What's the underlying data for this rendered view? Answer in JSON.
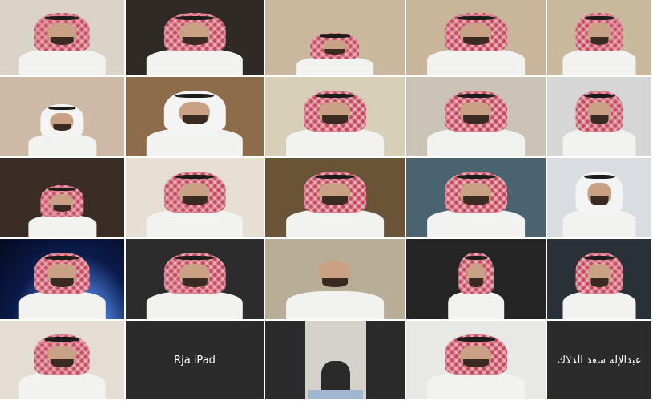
{
  "meeting": {
    "participants": [
      {
        "name": "",
        "bg": "#d9d3c8",
        "scarf": "red"
      },
      {
        "name": "",
        "bg": "#2f2a26",
        "scarf": "red"
      },
      {
        "name": "",
        "bg": "#c9b79e",
        "scarf": "red"
      },
      {
        "name": "",
        "bg": "#c9b59a",
        "scarf": "red"
      },
      {
        "name": "",
        "bg": "#c8b89c",
        "scarf": "red"
      },
      {
        "name": "",
        "bg": "#cdb9a5",
        "scarf": "white"
      },
      {
        "name": "",
        "bg": "#8c6c4a",
        "scarf": "white"
      },
      {
        "name": "",
        "bg": "#d8cfb8",
        "scarf": "red"
      },
      {
        "name": "",
        "bg": "#c9c4b6",
        "scarf": "red"
      },
      {
        "name": "",
        "bg": "#d6d6d6",
        "scarf": "red"
      },
      {
        "name": "",
        "bg": "#3a2d25",
        "scarf": "red"
      },
      {
        "name": "",
        "bg": "#e7dfd3",
        "scarf": "red"
      },
      {
        "name": "",
        "bg": "#6a5438",
        "scarf": "red"
      },
      {
        "name": "",
        "bg": "#4a6370",
        "scarf": "red"
      },
      {
        "name": "",
        "bg": "#d9dde2",
        "scarf": "white"
      },
      {
        "name": "",
        "bg": "#1a2f66",
        "scarf": "red"
      },
      {
        "name": "",
        "bg": "#2c2c2c",
        "scarf": "red"
      },
      {
        "name": "",
        "bg": "#b8ad96",
        "scarf": "none"
      },
      {
        "name": "",
        "bg": "#252525",
        "scarf": "red"
      },
      {
        "name": "",
        "bg": "#2a3038",
        "scarf": "red"
      },
      {
        "name": "",
        "bg": "#e4ddd4",
        "scarf": "red"
      },
      {
        "name": "Rja iPad",
        "bg": "#2b2b2b",
        "scarf": ""
      },
      {
        "name": "",
        "bg": "#2b2b2b",
        "scarf": "none"
      },
      {
        "name": "",
        "bg": "#e8e8e6",
        "scarf": "red"
      },
      {
        "name": "عبدالإله سعد الدلاك",
        "bg": "#2b2b2b",
        "scarf": ""
      }
    ]
  }
}
